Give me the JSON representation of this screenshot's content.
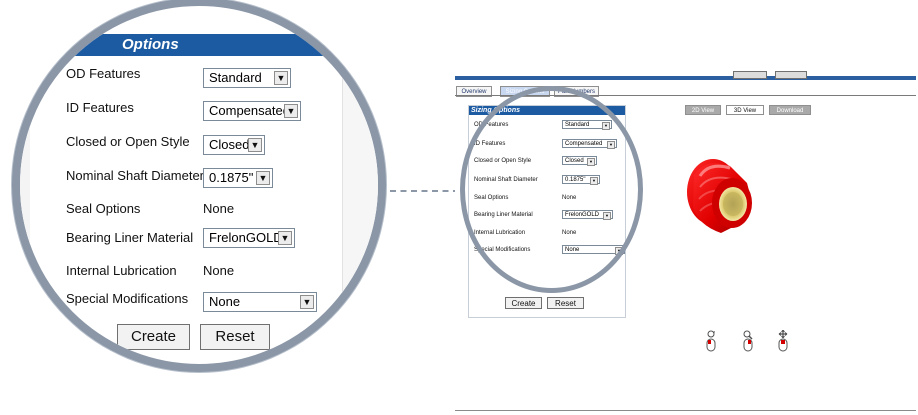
{
  "zoomed_panel": {
    "header_title": "Options",
    "rows": [
      {
        "label": "OD Features",
        "kind": "select",
        "value": "Standard"
      },
      {
        "label": "ID Features",
        "kind": "select",
        "value": "Compensated"
      },
      {
        "label": "Closed or Open Style",
        "kind": "select",
        "value": "Closed"
      },
      {
        "label": "Nominal Shaft Diameter",
        "kind": "select",
        "value": "0.1875\""
      },
      {
        "label": "Seal Options",
        "kind": "text",
        "value": "None"
      },
      {
        "label": "Bearing Liner Material",
        "kind": "select",
        "value": "FrelonGOLD"
      },
      {
        "label": "Internal Lubrication",
        "kind": "text",
        "value": "None"
      },
      {
        "label": "Special Modifications",
        "kind": "select",
        "value": "None"
      }
    ],
    "buttons": {
      "create": "Create",
      "reset": "Reset"
    }
  },
  "mini_ui": {
    "tabs": [
      {
        "label": "Overview",
        "active": false
      },
      {
        "label": "Sizing Options",
        "active": true
      },
      {
        "label": "Part Numbers",
        "active": false
      }
    ],
    "panel_title": "Sizing Options",
    "rows": [
      {
        "label": "OD Features",
        "kind": "select",
        "value": "Standard"
      },
      {
        "label": "ID Features",
        "kind": "select",
        "value": "Compensated"
      },
      {
        "label": "Closed or Open Style",
        "kind": "select",
        "value": "Closed"
      },
      {
        "label": "Nominal Shaft Diameter",
        "kind": "select",
        "value": "0.1875\""
      },
      {
        "label": "Seal Options",
        "kind": "text",
        "value": "None"
      },
      {
        "label": "Bearing Liner Material",
        "kind": "select",
        "value": "FrelonGOLD"
      },
      {
        "label": "Internal Lubrication",
        "kind": "text",
        "value": "None"
      },
      {
        "label": "Special Modifications",
        "kind": "select",
        "value": "None"
      }
    ],
    "buttons": {
      "create": "Create",
      "reset": "Reset"
    },
    "view_buttons": [
      {
        "label": "2D View",
        "active": false
      },
      {
        "label": "3D View",
        "active": true
      },
      {
        "label": "Download",
        "active": false
      }
    ]
  },
  "icons": {
    "rotate": "rotate-icon",
    "zoom": "zoom-icon",
    "pan": "pan-icon",
    "mouse": "mouse-icon"
  },
  "colors": {
    "header_blue": "#1c5aa2",
    "ring_gray": "#8b97a7",
    "bearing_red": "#e00000",
    "liner_gold": "#d9c76b"
  }
}
